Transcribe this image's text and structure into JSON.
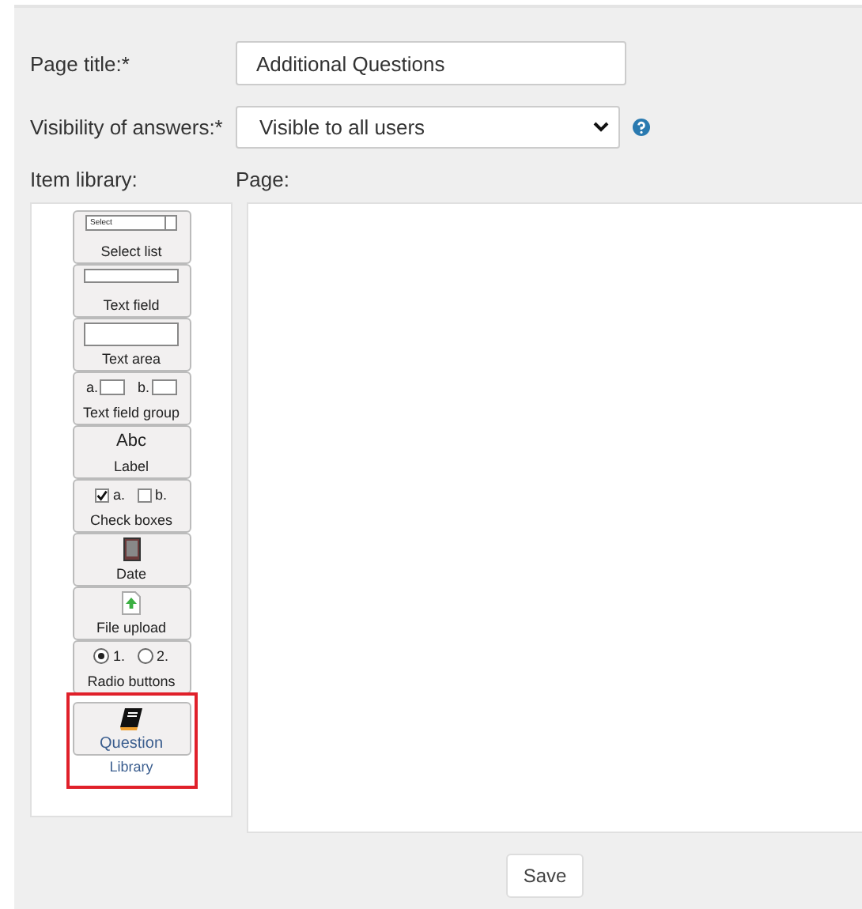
{
  "form": {
    "page_title_label": "Page title:*",
    "page_title_value": "Additional Questions",
    "visibility_label": "Visibility of answers:*",
    "visibility_value": "Visible to all users",
    "item_library_label": "Item library:",
    "page_label": "Page:"
  },
  "library_items": [
    {
      "kind": "select",
      "label": "Select list",
      "preview": "Select",
      "highlighted": false
    },
    {
      "kind": "textfield",
      "label": "Text field",
      "highlighted": false
    },
    {
      "kind": "textarea",
      "label": "Text area",
      "highlighted": false
    },
    {
      "kind": "fieldgroup",
      "label": "Text field group",
      "options": [
        {
          "label": "a."
        },
        {
          "label": "b."
        }
      ],
      "highlighted": false
    },
    {
      "kind": "label",
      "label": "Label",
      "preview": "Abc",
      "highlighted": false
    },
    {
      "kind": "checkboxes",
      "label": "Check boxes",
      "options": [
        {
          "label": "a.",
          "checked": true
        },
        {
          "label": "b.",
          "checked": false
        }
      ],
      "highlighted": false
    },
    {
      "kind": "date",
      "label": "Date",
      "highlighted": false
    },
    {
      "kind": "upload",
      "label": "File upload",
      "highlighted": false
    },
    {
      "kind": "radios",
      "label": "Radio buttons",
      "options": [
        {
          "label": "1.",
          "selected": true
        },
        {
          "label": "2.",
          "selected": false
        }
      ],
      "highlighted": false
    },
    {
      "kind": "library",
      "label": "Question",
      "caption": "Library",
      "highlighted": true
    }
  ],
  "save_button": "Save"
}
